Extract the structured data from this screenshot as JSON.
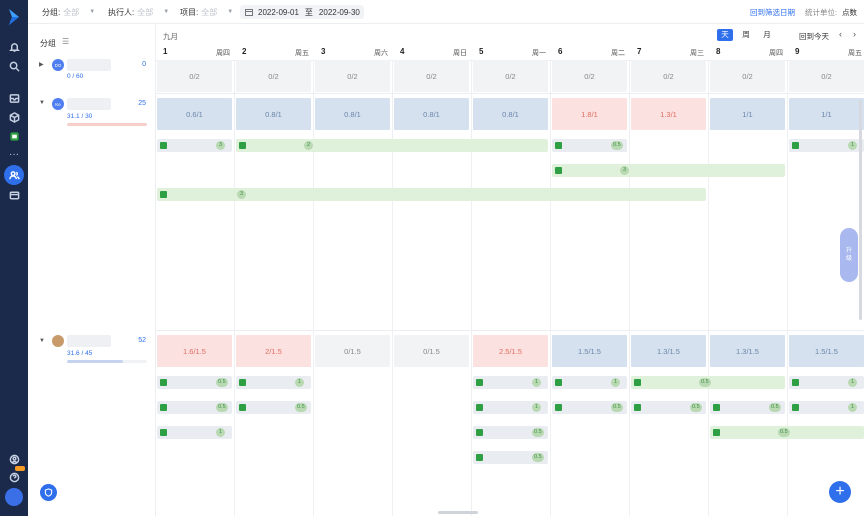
{
  "filters": {
    "group_label": "分组:",
    "group_value": "全部",
    "assignee_label": "执行人:",
    "assignee_value": "全部",
    "project_label": "项目:",
    "project_value": "全部",
    "date_start": "2022-09-01",
    "date_to": "至",
    "date_end": "2022-09-30",
    "back_to_filter": "回到筛选日期",
    "unit_label": "统计单位:",
    "unit_value": "点数"
  },
  "left_panel": {
    "title": "分组",
    "groups": [
      {
        "avatar": "DO",
        "count": "0",
        "ratio": "0 / 60",
        "avatar_color": "#4f7ef0",
        "load": 0
      },
      {
        "avatar": "Ke",
        "count": "25",
        "ratio": "31.1 / 30",
        "avatar_color": "#4f7ef0",
        "load": 1.0
      },
      {
        "avatar": "",
        "count": "52",
        "ratio": "31.6 / 45",
        "avatar_color": "#c89a6a",
        "load": 0.7
      }
    ]
  },
  "calendar": {
    "month": "九月",
    "view_day": "天",
    "view_week": "周",
    "view_month": "月",
    "back_today": "回到今天",
    "days": [
      {
        "num": "1",
        "wd": "周四"
      },
      {
        "num": "2",
        "wd": "周五"
      },
      {
        "num": "3",
        "wd": "周六"
      },
      {
        "num": "4",
        "wd": "周日"
      },
      {
        "num": "5",
        "wd": "周一"
      },
      {
        "num": "6",
        "wd": "周二"
      },
      {
        "num": "7",
        "wd": "周三"
      },
      {
        "num": "8",
        "wd": "周四"
      },
      {
        "num": "9",
        "wd": "周五"
      }
    ],
    "row1_capacity": [
      "0/2",
      "0/2",
      "0/2",
      "0/2",
      "0/2",
      "0/2",
      "0/2",
      "0/2",
      "0/2"
    ],
    "row2_capacity": [
      "0.6/1",
      "0.8/1",
      "0.8/1",
      "0.8/1",
      "0.8/1",
      "1.8/1",
      "1.3/1",
      "1/1",
      "1/1"
    ],
    "row3_capacity": [
      "1.6/1.5",
      "2/1.5",
      "0/1.5",
      "0/1.5",
      "2.5/1.5",
      "1.5/1.5",
      "1.3/1.5",
      "1.3/1.5",
      "1.5/1.5"
    ],
    "row2_tasks": [
      "3",
      "2",
      "0.5",
      "1",
      "3",
      "3"
    ],
    "row3_tasks": [
      "0.5",
      "1",
      "1",
      "1",
      "0.5",
      "1",
      "0.5",
      "0.5",
      "1",
      "0.5",
      "0.5",
      "0.5",
      "1",
      "1",
      "0.5",
      "0.5",
      "0.5",
      "1"
    ]
  },
  "colors": {
    "accent": "#2f6fec",
    "rail": "#1b2a4a"
  },
  "upgrade": {
    "label1": "升",
    "label2": "级"
  }
}
